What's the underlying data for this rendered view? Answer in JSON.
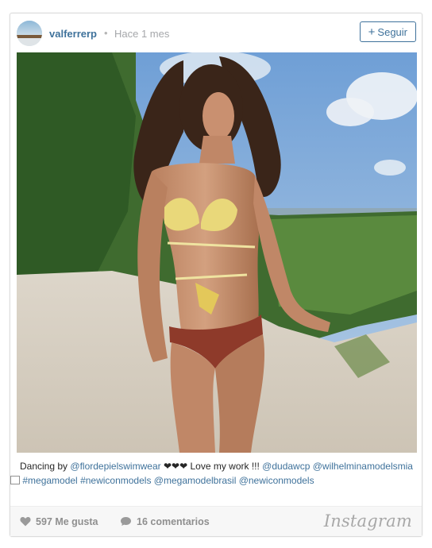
{
  "post": {
    "username": "valferrerp",
    "separator": "•",
    "time": "Hace 1 mes",
    "follow_label": "Seguir",
    "follow_icon": "plus-icon"
  },
  "caption": {
    "prefix": "Dancing by",
    "mention_1": "@flordepielswimwear",
    "hearts": "❤❤❤",
    "text_2": "Love my work !!!",
    "mention_2": "@dudawcp",
    "mention_3": "@wilhelminamodelsmia",
    "boxes": "⃞⃞⃞⃞",
    "tag_1": "#megamodel",
    "tag_2": "#newiconmodels",
    "mention_4": "@megamodelbrasil",
    "mention_5": "@newiconmodels"
  },
  "stats": {
    "likes": "597 Me gusta",
    "comments": "16 comentarios",
    "likes_icon": "heart-icon",
    "comments_icon": "speech-bubble-icon"
  },
  "brand": "Instagram",
  "colors": {
    "link": "#3f729b",
    "muted": "#a5a7aa"
  }
}
